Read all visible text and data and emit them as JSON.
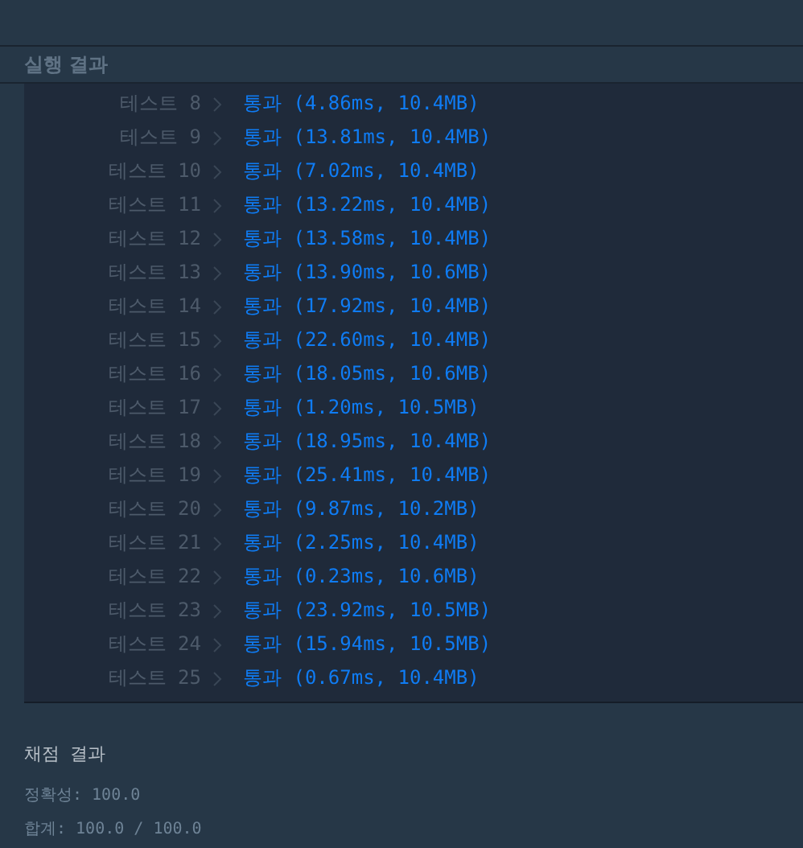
{
  "section_title": "실행 결과",
  "tests": [
    {
      "label": "테스트 8",
      "status": "통과",
      "detail": "(4.86ms, 10.4MB)"
    },
    {
      "label": "테스트 9",
      "status": "통과",
      "detail": "(13.81ms, 10.4MB)"
    },
    {
      "label": "테스트 10",
      "status": "통과",
      "detail": "(7.02ms, 10.4MB)"
    },
    {
      "label": "테스트 11",
      "status": "통과",
      "detail": "(13.22ms, 10.4MB)"
    },
    {
      "label": "테스트 12",
      "status": "통과",
      "detail": "(13.58ms, 10.4MB)"
    },
    {
      "label": "테스트 13",
      "status": "통과",
      "detail": "(13.90ms, 10.6MB)"
    },
    {
      "label": "테스트 14",
      "status": "통과",
      "detail": "(17.92ms, 10.4MB)"
    },
    {
      "label": "테스트 15",
      "status": "통과",
      "detail": "(22.60ms, 10.4MB)"
    },
    {
      "label": "테스트 16",
      "status": "통과",
      "detail": "(18.05ms, 10.6MB)"
    },
    {
      "label": "테스트 17",
      "status": "통과",
      "detail": "(1.20ms, 10.5MB)"
    },
    {
      "label": "테스트 18",
      "status": "통과",
      "detail": "(18.95ms, 10.4MB)"
    },
    {
      "label": "테스트 19",
      "status": "통과",
      "detail": "(25.41ms, 10.4MB)"
    },
    {
      "label": "테스트 20",
      "status": "통과",
      "detail": "(9.87ms, 10.2MB)"
    },
    {
      "label": "테스트 21",
      "status": "통과",
      "detail": "(2.25ms, 10.4MB)"
    },
    {
      "label": "테스트 22",
      "status": "통과",
      "detail": "(0.23ms, 10.6MB)"
    },
    {
      "label": "테스트 23",
      "status": "통과",
      "detail": "(23.92ms, 10.5MB)"
    },
    {
      "label": "테스트 24",
      "status": "통과",
      "detail": "(15.94ms, 10.5MB)"
    },
    {
      "label": "테스트 25",
      "status": "통과",
      "detail": "(0.67ms, 10.4MB)"
    }
  ],
  "grading": {
    "title": "채점 결과",
    "lines": [
      "정확성: 100.0",
      "합계: 100.0 / 100.0"
    ]
  }
}
